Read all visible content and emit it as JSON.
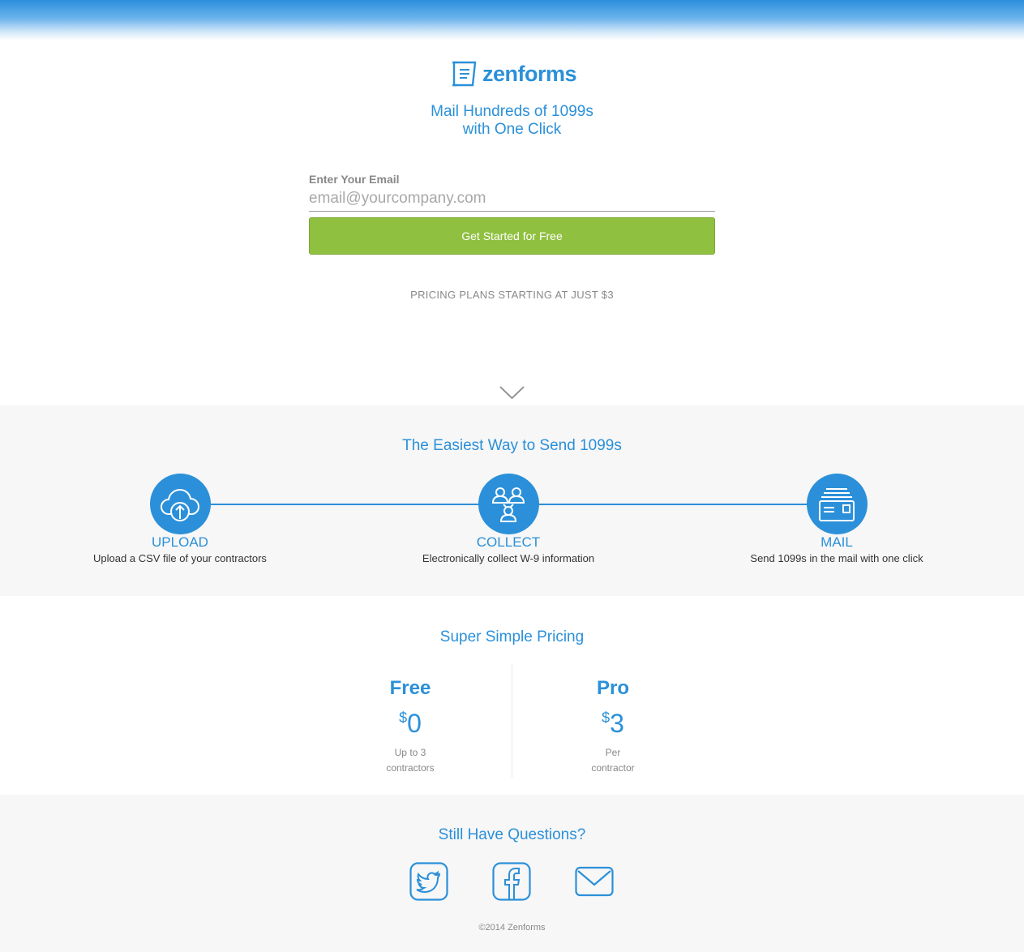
{
  "brand": {
    "name": "zenforms",
    "logo_icon": "document-scroll-icon",
    "color": "#2b90d9"
  },
  "hero": {
    "tagline_line1": "Mail Hundreds of 1099s",
    "tagline_line2": "with One Click",
    "email_label": "Enter Your Email",
    "email_placeholder": "email@yourcompany.com",
    "email_value": "",
    "cta_label": "Get Started for Free",
    "cta_color": "#8fc03f",
    "pricing_note": "PRICING PLANS STARTING AT JUST $3",
    "scroll_icon": "chevron-down-icon"
  },
  "steps": {
    "title": "The Easiest Way to Send 1099s",
    "items": [
      {
        "name": "UPLOAD",
        "desc": "Upload a CSV file of your contractors",
        "icon": "cloud-upload-icon"
      },
      {
        "name": "COLLECT",
        "desc": "Electronically collect W-9 information",
        "icon": "people-network-icon"
      },
      {
        "name": "MAIL",
        "desc": "Send 1099s in the mail with one click",
        "icon": "mail-stack-icon"
      }
    ]
  },
  "pricing": {
    "title": "Super Simple Pricing",
    "plans": [
      {
        "name": "Free",
        "currency": "$",
        "amount": "0",
        "desc_line1": "Up to 3",
        "desc_line2": "contractors"
      },
      {
        "name": "Pro",
        "currency": "$",
        "amount": "3",
        "desc_line1": "Per",
        "desc_line2": "contractor"
      }
    ]
  },
  "questions": {
    "title": "Still Have Questions?",
    "links": [
      {
        "icon": "twitter-icon"
      },
      {
        "icon": "facebook-icon"
      },
      {
        "icon": "email-envelope-icon"
      }
    ],
    "copyright": "©2014 Zenforms"
  }
}
